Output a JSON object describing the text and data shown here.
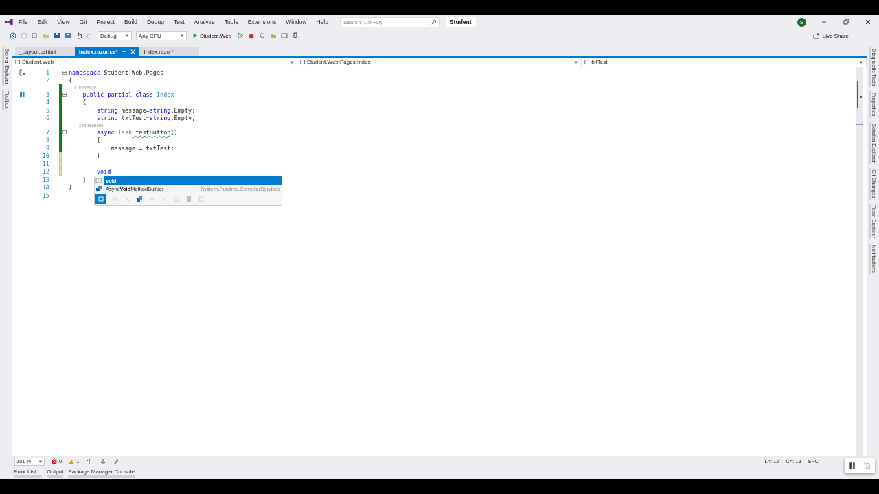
{
  "window": {
    "solution_name": "Student",
    "avatar": "S"
  },
  "menu": [
    "File",
    "Edit",
    "View",
    "Git",
    "Project",
    "Build",
    "Debug",
    "Test",
    "Analyze",
    "Tools",
    "Extensions",
    "Window",
    "Help"
  ],
  "search": {
    "placeholder": "Search (Ctrl+Q)"
  },
  "toolbar": {
    "configuration": "Debug",
    "platform": "Any CPU",
    "start_target": "Student.Web",
    "live_share": "Live Share"
  },
  "left_panels": [
    "Server Explorer",
    "Toolbox"
  ],
  "right_panels": [
    "Diagnostic Tools",
    "Properties",
    "Solution Explorer",
    "Git Changes",
    "Team Explorer",
    "Notifications"
  ],
  "tabs": [
    {
      "label": "_Layout.cshtml",
      "selected": false
    },
    {
      "label": "Index.razor.cs*",
      "selected": true
    },
    {
      "label": "Index.razor*",
      "selected": false
    }
  ],
  "nav_bar": [
    "Student.Web",
    "Student.Web.Pages.Index",
    "txtTest"
  ],
  "code": [
    {
      "kind": "line",
      "number": "1",
      "fold": true,
      "modified": false,
      "margin_glyph": {
        "kind": "scope"
      },
      "tokens": [
        {
          "kind": "keyword",
          "text": "namespace"
        },
        {
          "kind": "plain",
          "text": " Student.Web.Pages"
        }
      ]
    },
    {
      "kind": "line",
      "number": "2",
      "modified": false,
      "tokens": [
        {
          "kind": "plain",
          "text": "{"
        }
      ]
    },
    {
      "kind": "codelens",
      "modified": true,
      "saved": true,
      "text": "    1 reference"
    },
    {
      "kind": "line",
      "number": "3",
      "fold": true,
      "modified": true,
      "saved": true,
      "margin_glyph": {
        "kind": "members"
      },
      "tokens": [
        {
          "kind": "keyword",
          "text": "    public partial class"
        },
        {
          "kind": "type",
          "text": " Index"
        }
      ]
    },
    {
      "kind": "line",
      "number": "4",
      "modified": true,
      "saved": true,
      "tokens": [
        {
          "kind": "plain",
          "text": "    {"
        }
      ]
    },
    {
      "kind": "line",
      "number": "5",
      "modified": true,
      "saved": true,
      "tokens": [
        {
          "kind": "keyword",
          "text": "        string"
        },
        {
          "kind": "plain",
          "text": " message="
        },
        {
          "kind": "keyword",
          "text": "string"
        },
        {
          "kind": "plain",
          "text": ".Empty;"
        }
      ]
    },
    {
      "kind": "line",
      "number": "6",
      "modified": true,
      "saved": true,
      "tokens": [
        {
          "kind": "keyword",
          "text": "        string"
        },
        {
          "kind": "plain",
          "text": " txtTest="
        },
        {
          "kind": "keyword",
          "text": "string"
        },
        {
          "kind": "plain",
          "text": ".Empty;"
        }
      ]
    },
    {
      "kind": "codelens",
      "modified": true,
      "saved": true,
      "text": "        2 references"
    },
    {
      "kind": "line",
      "number": "7",
      "fold": true,
      "modified": true,
      "saved": true,
      "tokens": [
        {
          "kind": "keyword",
          "text": "        async"
        },
        {
          "kind": "type",
          "text": " Task"
        },
        {
          "kind": "warning",
          "text": " testButton"
        },
        {
          "kind": "plain",
          "text": "()"
        }
      ]
    },
    {
      "kind": "line",
      "number": "8",
      "modified": true,
      "saved": true,
      "tokens": [
        {
          "kind": "plain",
          "text": "        {"
        }
      ]
    },
    {
      "kind": "line",
      "number": "9",
      "modified": true,
      "saved": true,
      "tokens": [
        {
          "kind": "plain",
          "text": "            message = txtTest;"
        }
      ]
    },
    {
      "kind": "line",
      "number": "10",
      "modified": true,
      "saved": false,
      "tokens": [
        {
          "kind": "plain",
          "text": "        }"
        }
      ]
    },
    {
      "kind": "line",
      "number": "11",
      "modified": true,
      "saved": false
    },
    {
      "kind": "line",
      "number": "12",
      "modified": true,
      "saved": false,
      "caret": true,
      "tokens": [
        {
          "kind": "keyword",
          "text": "        void"
        }
      ]
    },
    {
      "kind": "line",
      "number": "13",
      "modified": false,
      "tokens": [
        {
          "kind": "plain",
          "text": "    }"
        }
      ]
    },
    {
      "kind": "line",
      "number": "14",
      "modified": false,
      "tokens": [
        {
          "kind": "plain",
          "text": "}"
        }
      ]
    },
    {
      "kind": "line",
      "number": "15",
      "modified": false
    }
  ],
  "completion": {
    "items": [
      {
        "kind": "keyword",
        "label": "void",
        "selected": true
      },
      {
        "kind": "class",
        "label": "Async**Void**MethodBuilder",
        "namespace": "System.Runtime.CompilerServices",
        "selected": false
      }
    ]
  },
  "editor_status": {
    "zoom": "101 %",
    "errors": "0",
    "warnings": "1",
    "position": [
      "Ln: 12",
      "Ch: 13",
      "SPC"
    ]
  },
  "bottom_tabs": [
    "Error List ...",
    "Output",
    "Package Manager Console"
  ]
}
